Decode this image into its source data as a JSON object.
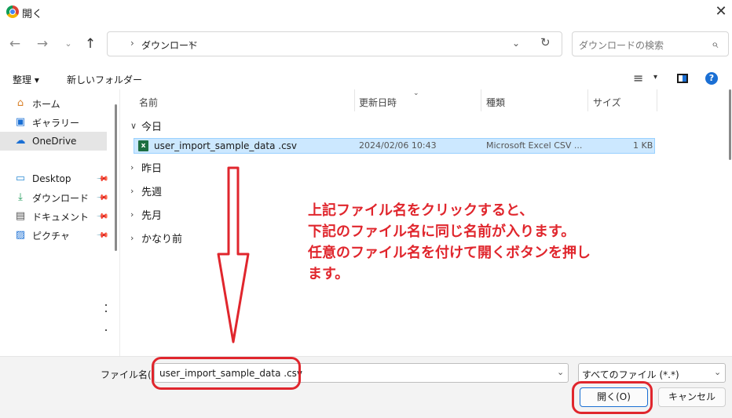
{
  "window": {
    "title": "開く",
    "close_glyph": "✕"
  },
  "nav": {
    "back": "←",
    "forward": "→",
    "recent": "⌄",
    "up": "↑",
    "separator": "›",
    "breadcrumb": "ダウンロード",
    "address_dropdown": "⌄",
    "refresh": "↻",
    "search_placeholder": "ダウンロードの検索",
    "search_glyph": "⌕"
  },
  "toolbar": {
    "organize": "整理 ▾",
    "new_folder": "新しいフォルダー",
    "view_menu": "≡",
    "view_dropdown": "▾",
    "help": "?"
  },
  "sidebar": {
    "items": [
      {
        "label": "ホーム",
        "icon": "home-icon",
        "glyph": "⌂"
      },
      {
        "label": "ギャラリー",
        "icon": "gallery-icon",
        "glyph": "▣"
      },
      {
        "label": "OneDrive",
        "icon": "cloud-icon",
        "glyph": "☁"
      },
      {
        "label": "Desktop",
        "icon": "desktop-icon",
        "glyph": "▭"
      },
      {
        "label": "ダウンロード",
        "icon": "download-icon",
        "glyph": "⤓"
      },
      {
        "label": "ドキュメント",
        "icon": "document-icon",
        "glyph": "▤"
      },
      {
        "label": "ピクチャ",
        "icon": "picture-icon",
        "glyph": "▨"
      }
    ],
    "pin_glyph": "📌"
  },
  "columns": {
    "name": "名前",
    "modified": "更新日時",
    "type": "種類",
    "size": "サイズ",
    "sort_glyph": "⌄"
  },
  "groups": [
    {
      "label": "今日",
      "chevron": "∨"
    },
    {
      "label": "昨日",
      "chevron": "›"
    },
    {
      "label": "先週",
      "chevron": "›"
    },
    {
      "label": "先月",
      "chevron": "›"
    },
    {
      "label": "かなり前",
      "chevron": "›"
    }
  ],
  "file": {
    "icon_letter": "x",
    "name": "user_import_sample_data .csv",
    "modified": "2024/02/06 10:43",
    "type": "Microsoft Excel CSV ...",
    "size": "1 KB"
  },
  "footer": {
    "filename_label": "ファイル名(N):",
    "filename_value": "user_import_sample_data .csv",
    "dropdown": "⌄",
    "filetype_value": "すべてのファイル (*.*)",
    "open_label": "開く(O)",
    "cancel_label": "キャンセル"
  },
  "annotation": {
    "lines": [
      "上記ファイル名をクリックすると、",
      "下記のファイル名に同じ名前が入ります。",
      "任意のファイル名を付けて開くボタンを押し",
      "ます。"
    ],
    "color": "#e0262d"
  },
  "colors": {
    "accent": "#1a6fd4",
    "selection": "#cce8ff",
    "excel_green": "#1d6f42"
  }
}
